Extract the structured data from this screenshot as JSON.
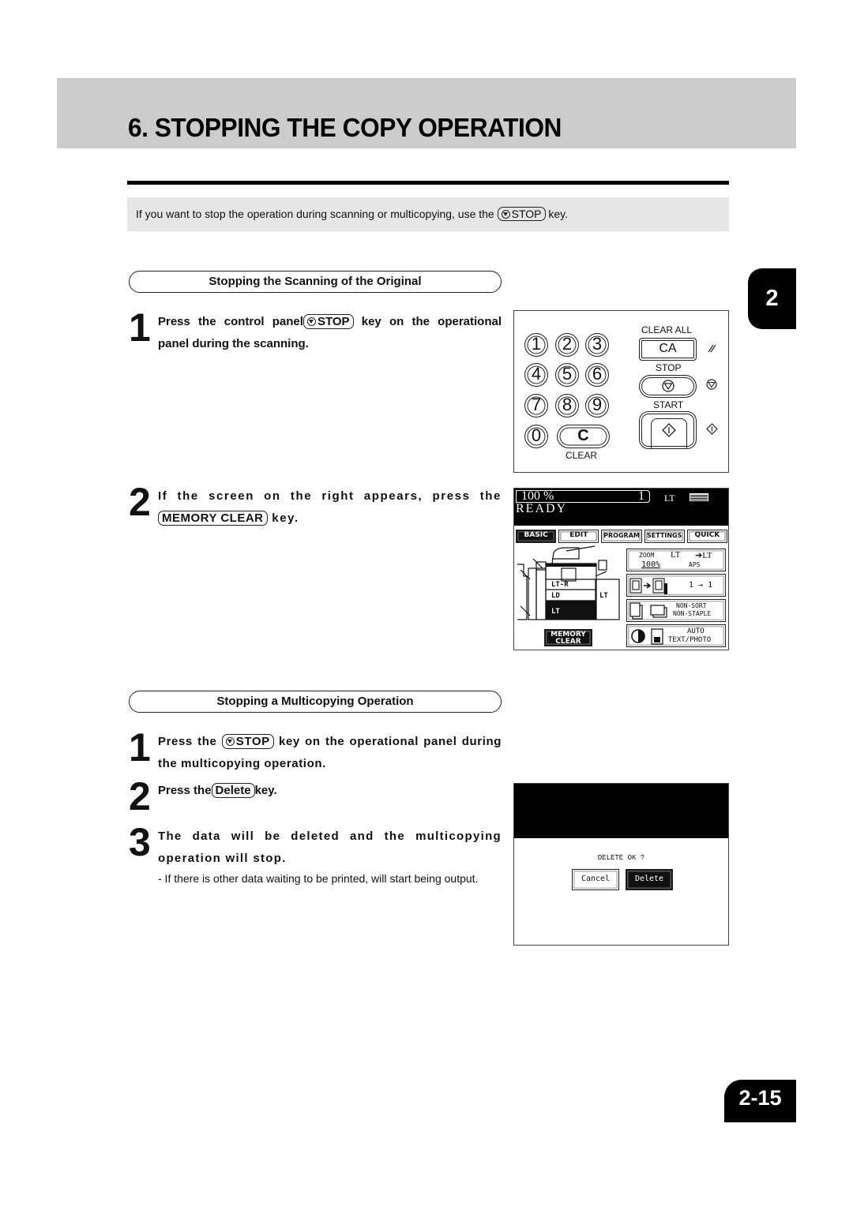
{
  "header": {
    "title": "6. STOPPING THE COPY OPERATION"
  },
  "intro": {
    "before": "If you want to stop the operation during scanning or multicopying, use the",
    "key_label": "STOP",
    "after": "key."
  },
  "section1": {
    "heading": "Stopping the Scanning of the Original",
    "steps": [
      {
        "number": "1",
        "before": "Press the control panel",
        "key_label": "STOP",
        "after": "key on the operational panel during the scanning."
      },
      {
        "number": "2",
        "before": "If the screen on the right appears, press the",
        "key_label": "MEMORY CLEAR",
        "after": "key."
      }
    ]
  },
  "section2": {
    "heading": "Stopping a Multicopying Operation",
    "steps": [
      {
        "number": "1",
        "before": "Press the",
        "key_label": "STOP",
        "after": "key on the operational panel during the multicopying operation."
      },
      {
        "number": "2",
        "before": "Press the",
        "key_label": "Delete",
        "after": "key."
      },
      {
        "number": "3",
        "text": "The data will be deleted and the multicopying operation will stop.",
        "note": "- If there is other data waiting to be printed, will start being output."
      }
    ]
  },
  "control_panel": {
    "keys": [
      "1",
      "2",
      "3",
      "4",
      "5",
      "6",
      "7",
      "8",
      "9",
      "0"
    ],
    "clear_key": "C",
    "clear_label": "CLEAR",
    "clear_all_label": "CLEAR ALL",
    "clear_all_key": "CA",
    "stop_label": "STOP",
    "start_label": "START",
    "icons": [
      "clear-all-icon",
      "stop-icon",
      "start-icon"
    ]
  },
  "touch_screen": {
    "zoom": "100 %",
    "copies": "1",
    "paper": "LT",
    "status": "READY",
    "tabs": [
      {
        "label": "BASIC",
        "active": true
      },
      {
        "label": "EDIT",
        "active": false
      },
      {
        "label": "PROGRAM",
        "active": false
      },
      {
        "label": "SETTINGS",
        "active": false
      },
      {
        "label": "QUICK",
        "active": false
      }
    ],
    "drawers": [
      "LT-R",
      "LD",
      "LT"
    ],
    "bypass": "LT",
    "zoom_button": {
      "label": "ZOOM",
      "value": "100%",
      "src": "LT",
      "dst": "LT",
      "mode": "APS"
    },
    "duplex_button": {
      "value": "1 → 1"
    },
    "finishing_button": {
      "line1": "NON-SORT",
      "line2": "NON-STAPLE"
    },
    "mode_button": {
      "line1": "AUTO",
      "line2": "TEXT/PHOTO"
    },
    "memory_clear": {
      "line1": "MEMORY",
      "line2": "CLEAR"
    }
  },
  "delete_dialog": {
    "question": "DELETE OK ?",
    "cancel_label": "Cancel",
    "delete_label": "Delete"
  },
  "side_tab": "2",
  "page_number": "2-15"
}
